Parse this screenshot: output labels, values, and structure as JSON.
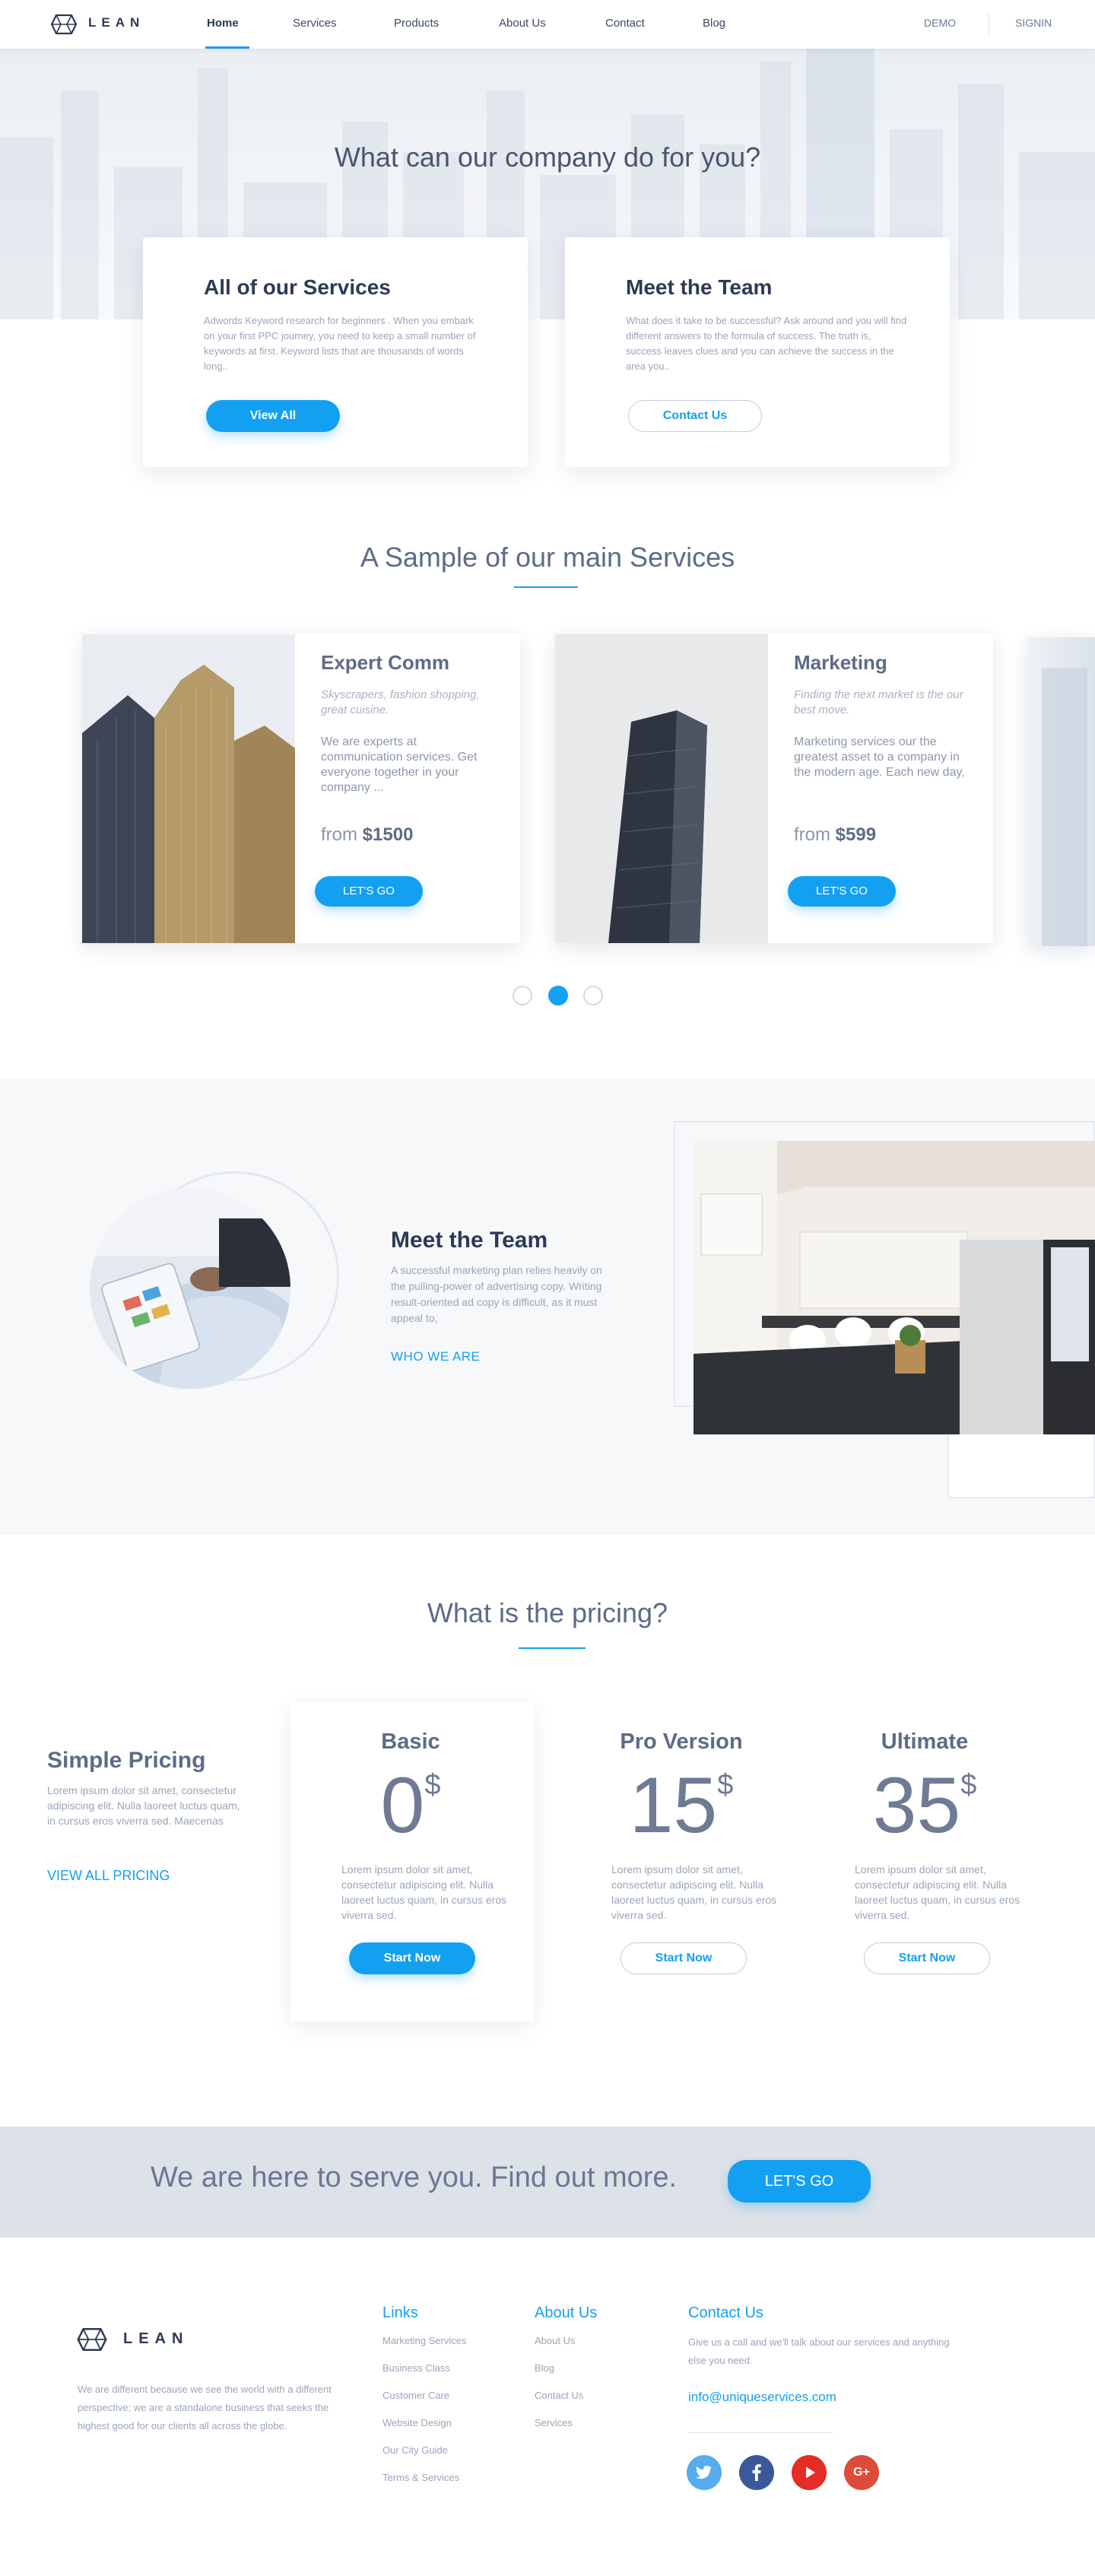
{
  "nav": {
    "brand": "LEAN",
    "links": [
      "Home",
      "Services",
      "Products",
      "About Us",
      "Contact",
      "Blog"
    ],
    "active": "Home",
    "demo": "DEMO",
    "signin": "SIGNIN"
  },
  "hero": {
    "title": "What can our company do for you?",
    "cards": [
      {
        "title": "All of our Services",
        "text": "Adwords Keyword research for beginners . When you embark on your first PPC journey, you need to keep a small number of keywords at first. Keyword lists that are thousands of words long..",
        "button": "View All"
      },
      {
        "title": "Meet the Team",
        "text": "What does it take to be successful? Ask around and you will find different answers to the formula of success. The truth is, success leaves clues and you can achieve the success in the area you..",
        "button": "Contact Us"
      }
    ]
  },
  "services": {
    "title": "A Sample of our main Services",
    "cards": [
      {
        "title": "Expert Comm",
        "tagline": "Skyscrapers, fashion shopping, great cuisine.",
        "text": "We are experts at communication services. Get everyone together in your company ...",
        "price_prefix": "from",
        "price": "$1500",
        "button": "LET'S GO"
      },
      {
        "title": "Marketing",
        "tagline": "Finding the next market is the our best move.",
        "text": "Marketing services our the greatest asset to a company in the modern age. Each new day,",
        "price_prefix": "from",
        "price": "$599",
        "button": "LET'S GO"
      }
    ],
    "active_dot": 2
  },
  "team": {
    "title": "Meet the Team",
    "text": "A successful marketing plan relies heavily on the pulling-power of advertising copy. Writing result-oriented ad copy is difficult, as it must appeal to,",
    "link": "WHO WE ARE"
  },
  "pricing": {
    "title": "What is the pricing?",
    "intro_title": "Simple Pricing",
    "intro_text": "Lorem ipsum dolor sit amet, consectetur adipiscing elit. Nulla laoreet luctus quam, in cursus eros viverra sed. Maecenas",
    "intro_link": "VIEW ALL PRICING",
    "plans": [
      {
        "name": "Basic",
        "price": "0",
        "currency": "$",
        "text": "Lorem ipsum dolor sit amet, consectetur adipiscing elit. Nulla laoreet luctus quam, in cursus eros viverra sed.",
        "button": "Start Now"
      },
      {
        "name": "Pro Version",
        "price": "15",
        "currency": "$",
        "text": "Lorem ipsum dolor sit amet, consectetur adipiscing elit. Nulla laoreet luctus quam, in cursus eros viverra sed.",
        "button": "Start Now"
      },
      {
        "name": "Ultimate",
        "price": "35",
        "currency": "$",
        "text": "Lorem ipsum dolor sit amet, consectetur adipiscing elit. Nulla laoreet luctus quam, in cursus eros viverra sed.",
        "button": "Start Now"
      }
    ]
  },
  "cta": {
    "text": "We are here to serve you. Find out more.",
    "button": "LET'S GO"
  },
  "footer": {
    "brand": "LEAN",
    "about": "We are different because we see the world with a different perspective; we are a standalone business that seeks the highest good for our clients all across the globe.",
    "links_title": "Links",
    "links": [
      "Marketing Services",
      "Business Class",
      "Customer Care",
      "Website Design",
      "Our City Guide",
      "Terms & Services"
    ],
    "about_title": "About Us",
    "about_links": [
      "About Us",
      "Blog",
      "Contact Us",
      "Services"
    ],
    "contact_title": "Contact Us",
    "contact_text": "Give us a call and we'll talk about our services and anything else you need.",
    "email": "info@uniqueservices.com",
    "social": [
      "twitter-icon",
      "facebook-icon",
      "youtube-icon",
      "google-plus-icon"
    ]
  },
  "colors": {
    "accent": "#14a0f0",
    "heading": "#2d3a55",
    "text": "#5d6b87",
    "muted": "#9aa5b8"
  }
}
